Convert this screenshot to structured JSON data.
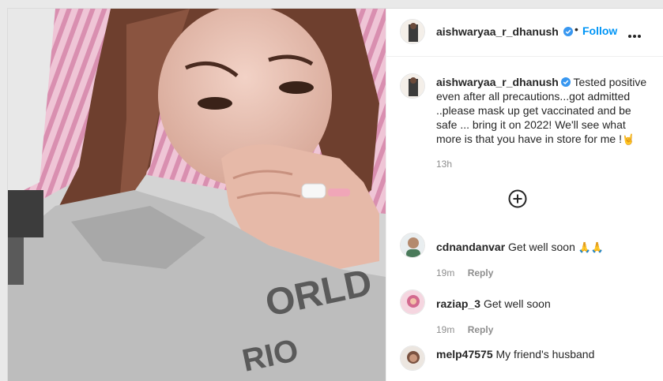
{
  "post": {
    "author": "aishwaryaa_r_dhanush",
    "verified": true,
    "follow_label": "Follow",
    "separator": "•",
    "caption": "Tested positive even after all precautions...got admitted ..please mask up get vaccinated and be safe ... bring it on 2022! We'll see what more is that you have in store for me !",
    "caption_emoji": "🤘",
    "caption_time": "13h"
  },
  "comments": [
    {
      "username": "cdnandanvar",
      "text": "Get well soon",
      "emoji": "🙏🙏",
      "time": "19m",
      "reply_label": "Reply"
    },
    {
      "username": "raziap_3",
      "text": "Get well soon",
      "emoji": "",
      "time": "19m",
      "reply_label": "Reply"
    },
    {
      "username": "melp47575",
      "text": "My friend's husband",
      "emoji": "",
      "time": "",
      "reply_label": ""
    }
  ],
  "colors": {
    "link_blue": "#0095f6",
    "verified_blue": "#3897f0",
    "secondary_text": "#8e8e8e"
  },
  "icons": {
    "verified": "verified-badge-icon",
    "more": "more-options-icon",
    "load_more": "plus-circle-icon"
  }
}
